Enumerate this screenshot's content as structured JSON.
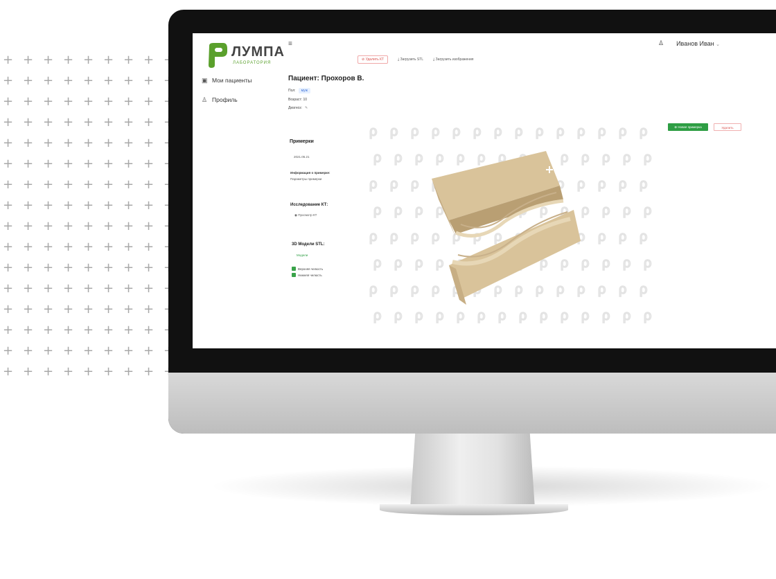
{
  "sidebar": {
    "logo_name": "ЛУМПА",
    "logo_sub": "ЛАБОРАТОРИЯ",
    "items": [
      {
        "label": "Мои пациенты",
        "icon": "calendar-icon"
      },
      {
        "label": "Профиль",
        "icon": "user-icon"
      }
    ]
  },
  "header": {
    "user_name": "Иванов Иван",
    "user_icon": "user-icon",
    "menu_icon": "menu-icon"
  },
  "toolbar": {
    "delete_label": "Удалить КТ",
    "upload_stl_label": "Загрузить STL",
    "upload_images_label": "Загрузить изображения"
  },
  "patient": {
    "title": "Пациент: Прохоров В.",
    "sex_label": "Пол:",
    "sex_value": "муж",
    "age_label": "Возраст: 10",
    "diagnosis_label": "Диагноз:"
  },
  "panel": {
    "fittings_title": "Примерки",
    "fitting_date": "2021.05.21",
    "fitting_info_title": "Информация о примерке:",
    "fitting_info_text": "Параметры примерки",
    "kt_title": "Исследование КТ:",
    "kt_link": "Просмотр КТ",
    "models_title": "3D Модели STL:",
    "models_link": "Модели",
    "upper_jaw": "Верхняя челюсть",
    "lower_jaw": "Нижняя челюсть"
  },
  "actions": {
    "new_fitting": "Новая примерка",
    "delete": "Удалить"
  },
  "colors": {
    "accent_green": "#2e9e44",
    "danger_red": "#d9534f",
    "model_beige": "#d9c39a"
  }
}
